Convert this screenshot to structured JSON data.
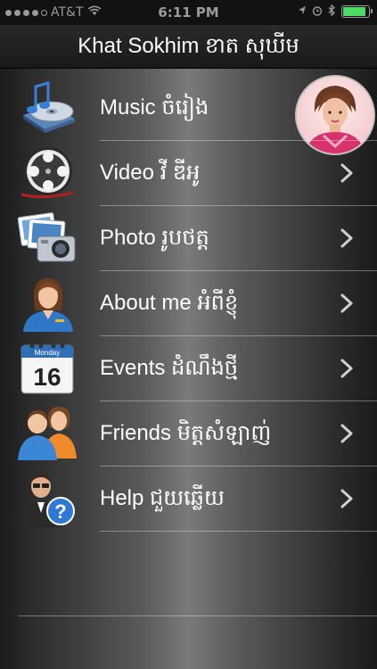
{
  "status_bar": {
    "carrier": "AT&T",
    "time": "6:11 PM"
  },
  "header": {
    "title": "Khat Sokhim ខាត សុឃីម"
  },
  "menu": {
    "items": [
      {
        "label": "Music ចំរៀង",
        "icon": "music-cd-icon",
        "has_chevron": false
      },
      {
        "label": "Video វី ឌីអូ",
        "icon": "film-reel-icon",
        "has_chevron": true
      },
      {
        "label": "Photo រូបថត្ត",
        "icon": "camera-photos-icon",
        "has_chevron": true
      },
      {
        "label": "About me អំពីខ្ញុំ",
        "icon": "woman-profile-icon",
        "has_chevron": true
      },
      {
        "label": "Events ដំណឹងថ្មី",
        "icon": "calendar-icon",
        "has_chevron": true
      },
      {
        "label": "Friends មិត្តសំឡាញ់",
        "icon": "friends-icon",
        "has_chevron": true
      },
      {
        "label": "Help ជួយឆ្លើយ",
        "icon": "help-person-icon",
        "has_chevron": true
      }
    ]
  },
  "calendar_icon": {
    "month": "Monday",
    "day": "16"
  },
  "colors": {
    "nav_bar": "#1f1f1f",
    "text": "#ffffff",
    "chevron": "#d0d0d0",
    "battery": "#4cd964"
  },
  "battery_level": 0.9
}
